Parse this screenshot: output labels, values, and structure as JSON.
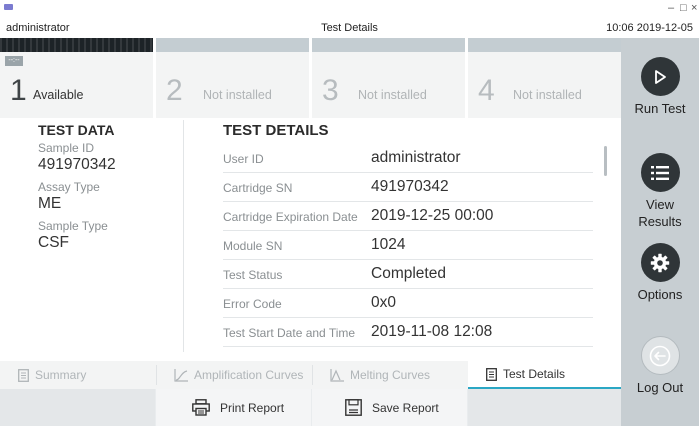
{
  "titlebar": {
    "user": "administrator",
    "title": "Test Details",
    "clock": "10:06 2019-12-05",
    "minimize": "–",
    "maximize": "□",
    "close": "×"
  },
  "slots": [
    {
      "number": "1",
      "status": "Available",
      "tag": "--:--"
    },
    {
      "number": "2",
      "status": "Not installed"
    },
    {
      "number": "3",
      "status": "Not installed"
    },
    {
      "number": "4",
      "status": "Not installed"
    }
  ],
  "sidebar": {
    "run_test": "Run Test",
    "view_results_line1": "View",
    "view_results_line2": "Results",
    "options": "Options",
    "log_out": "Log Out"
  },
  "test_data": {
    "heading": "TEST DATA",
    "sample_id_label": "Sample ID",
    "sample_id": "491970342",
    "assay_type_label": "Assay Type",
    "assay_type": "ME",
    "sample_type_label": "Sample Type",
    "sample_type": "CSF"
  },
  "test_details": {
    "heading": "TEST DETAILS",
    "rows": [
      {
        "key": "User ID",
        "value": "administrator"
      },
      {
        "key": "Cartridge SN",
        "value": "491970342"
      },
      {
        "key": "Cartridge Expiration Date",
        "value": "2019-12-25 00:00"
      },
      {
        "key": "Module SN",
        "value": "1024"
      },
      {
        "key": "Test Status",
        "value": "Completed"
      },
      {
        "key": "Error Code",
        "value": "0x0"
      },
      {
        "key": "Test Start Date and Time",
        "value": "2019-11-08 12:08"
      }
    ]
  },
  "tabs": {
    "summary": "Summary",
    "amplification": "Amplification Curves",
    "melting": "Melting Curves",
    "details": "Test Details"
  },
  "actions": {
    "print_report": "Print Report",
    "save_report": "Save Report"
  },
  "colors": {
    "sidebar": "#c7ced2",
    "active_tab_underline": "#2aa7c4",
    "dark_button": "#2f3538"
  }
}
